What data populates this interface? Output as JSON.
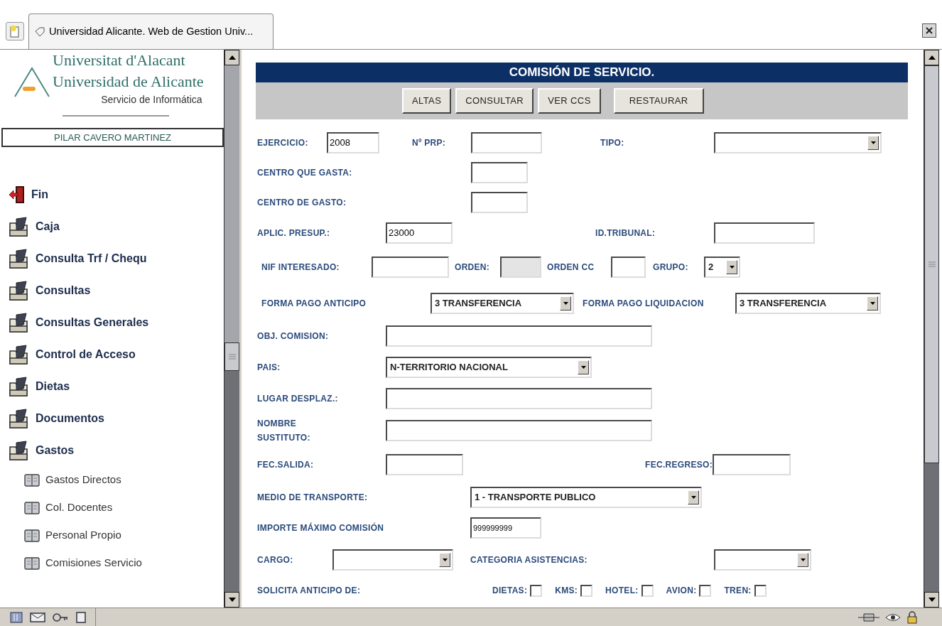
{
  "tab": {
    "title": "Universidad Alicante. Web de Gestion Univ..."
  },
  "sidebar": {
    "logo": {
      "line1": "Universitat d'Alacant",
      "line2": "Universidad de Alicante",
      "subtitle": "Servicio de Informática"
    },
    "user": "PILAR CAVERO MARTINEZ",
    "menu": [
      {
        "label": "Fin",
        "kind": "exit"
      },
      {
        "label": "Caja",
        "kind": "folder"
      },
      {
        "label": "Consulta Trf / Chequ",
        "kind": "folder"
      },
      {
        "label": "Consultas",
        "kind": "folder"
      },
      {
        "label": "Consultas Generales",
        "kind": "folder"
      },
      {
        "label": "Control de Acceso",
        "kind": "folder"
      },
      {
        "label": "Dietas",
        "kind": "folder"
      },
      {
        "label": "Documentos",
        "kind": "folder"
      },
      {
        "label": "Gastos",
        "kind": "folder",
        "children": [
          {
            "label": "Gastos Directos"
          },
          {
            "label": "Col. Docentes"
          },
          {
            "label": "Personal Propio"
          },
          {
            "label": "Comisiones Servicio"
          }
        ]
      }
    ]
  },
  "form": {
    "title": "COMISIÓN DE SERVICIO.",
    "buttons": [
      "ALTAS",
      "CONSULTAR",
      "VER CCS",
      "RESTAURAR"
    ],
    "ejercicio": {
      "label": "EJERCICIO:",
      "value": "2008"
    },
    "n_prp": {
      "label": "Nº PRP:"
    },
    "tipo": {
      "label": "TIPO:"
    },
    "centro_que_gasta": {
      "label": "CENTRO QUE GASTA:"
    },
    "centro_de_gasto": {
      "label": "CENTRO DE GASTO:"
    },
    "aplic_presup": {
      "label": "APLIC. PRESUP.:",
      "value": "23000"
    },
    "id_tribunal": {
      "label": "ID.TRIBUNAL:"
    },
    "nif_interesado": {
      "label": "NIF INTERESADO:"
    },
    "orden": {
      "label": "ORDEN:",
      "disabled": true
    },
    "orden_cc": {
      "label": "ORDEN CC"
    },
    "grupo": {
      "label": "GRUPO:",
      "value": "2"
    },
    "forma_pago_anticipo": {
      "label": "FORMA PAGO ANTICIPO",
      "value": "3 TRANSFERENCIA"
    },
    "forma_pago_liquidacion": {
      "label": "FORMA PAGO LIQUIDACION",
      "value": "3 TRANSFERENCIA"
    },
    "obj_comision": {
      "label": "OBJ. COMISION:"
    },
    "pais": {
      "label": "PAIS:",
      "value": "N-TERRITORIO NACIONAL"
    },
    "lugar_desplaz": {
      "label": "LUGAR DESPLAZ.:"
    },
    "nombre_sustituto": {
      "label": "NOMBRE SUSTITUTO:"
    },
    "fec_salida": {
      "label": "FEC.SALIDA:"
    },
    "fec_regreso": {
      "label": "FEC.REGRESO:"
    },
    "medio_transporte": {
      "label": "MEDIO DE TRANSPORTE:",
      "value": "1 - TRANSPORTE PUBLICO"
    },
    "importe_maximo": {
      "label": "IMPORTE MÁXIMO COMISIÓN",
      "value": "999999999"
    },
    "cargo": {
      "label": "CARGO:"
    },
    "categoria_asistencias": {
      "label": "CATEGORIA ASISTENCIAS:"
    },
    "solicita_anticipo": {
      "label": "SOLICITA ANTICIPO DE:",
      "options": [
        {
          "label": "DIETAS:",
          "checked": false
        },
        {
          "label": "KMS:",
          "checked": false
        },
        {
          "label": "HOTEL:",
          "checked": false
        },
        {
          "label": "AVION:",
          "checked": false
        },
        {
          "label": "TREN:",
          "checked": false
        }
      ]
    }
  }
}
